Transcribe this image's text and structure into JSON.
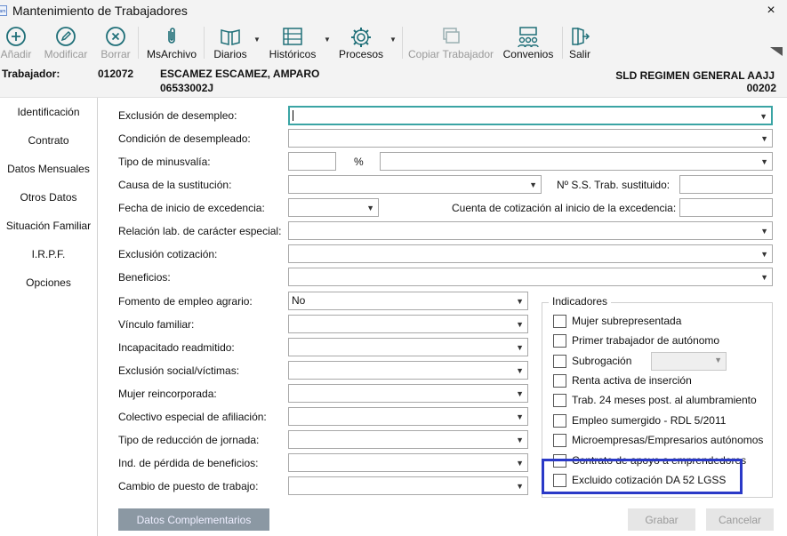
{
  "window": {
    "title": "Mantenimiento de Trabajadores",
    "close": "×",
    "app_icon_text": "am"
  },
  "toolbar": {
    "anadir": "Añadir",
    "modificar": "Modificar",
    "borrar": "Borrar",
    "msarchivo": "MsArchivo",
    "diarios": "Diarios",
    "historicos": "Históricos",
    "procesos": "Procesos",
    "copiar": "Copiar Trabajador",
    "convenios": "Convenios",
    "salir": "Salir",
    "icons": [
      "add-icon",
      "edit-icon",
      "delete-icon",
      "paperclip-icon",
      "book-icon",
      "list-icon",
      "gear-icon",
      "copy-icon",
      "people-icon",
      "exit-icon"
    ]
  },
  "worker": {
    "label": "Trabajador:",
    "code": "012072",
    "name": "ESCAMEZ ESCAMEZ, AMPARO",
    "id": "06533002J",
    "regime": "SLD REGIMEN GENERAL AAJJ",
    "regime_code": "00202"
  },
  "nav": [
    "Identificación",
    "Contrato",
    "Datos Mensuales",
    "Otros Datos",
    "Situación Familiar",
    "I.R.P.F.",
    "Opciones"
  ],
  "form": {
    "exclusion_desempleo": "Exclusión de desempleo:",
    "condicion_desempleado": "Condición de desempleado:",
    "tipo_minusvalia": "Tipo de minusvalía:",
    "percent": "%",
    "causa_sustitucion": "Causa de la sustitución:",
    "nss_sustituido": "Nº S.S. Trab. sustituido:",
    "fecha_excedencia": "Fecha de inicio de excedencia:",
    "cuenta_cotizacion": "Cuenta de cotización al inicio de la excedencia:",
    "relacion_laboral": "Relación lab. de carácter especial:",
    "exclusion_cotizacion": "Exclusión cotización:",
    "beneficios": "Beneficios:",
    "fomento_empleo": "Fomento de empleo agrario:",
    "fomento_value": "No",
    "vinculo_familiar": "Vínculo familiar:",
    "incapacitado": "Incapacitado readmitido:",
    "exclusion_social": "Exclusión social/víctimas:",
    "mujer_reincorporada": "Mujer reincorporada:",
    "colectivo_especial": "Colectivo especial de afiliación:",
    "tipo_reduccion": "Tipo de reducción de jornada:",
    "ind_perdida": "Ind. de pérdida de beneficios:",
    "cambio_puesto": "Cambio de puesto de trabajo:"
  },
  "indicadores": {
    "title": "Indicadores",
    "items": [
      "Mujer subrepresentada",
      "Primer trabajador de autónomo",
      "Subrogación",
      "Renta activa de inserción",
      "Trab. 24 meses post. al alumbramiento",
      "Empleo sumergido - RDL 5/2011",
      "Microempresas/Empresarios autónomos",
      "Contrato de apoyo a emprendedores",
      "Excluido cotización DA 52 LGSS"
    ]
  },
  "buttons": {
    "datos": "Datos Complementarios",
    "grabar": "Grabar",
    "cancelar": "Cancelar"
  },
  "colors": {
    "highlight": "#2a39c7",
    "focus": "#3aa4a4",
    "toolbar_icon": "#1f6f78"
  }
}
